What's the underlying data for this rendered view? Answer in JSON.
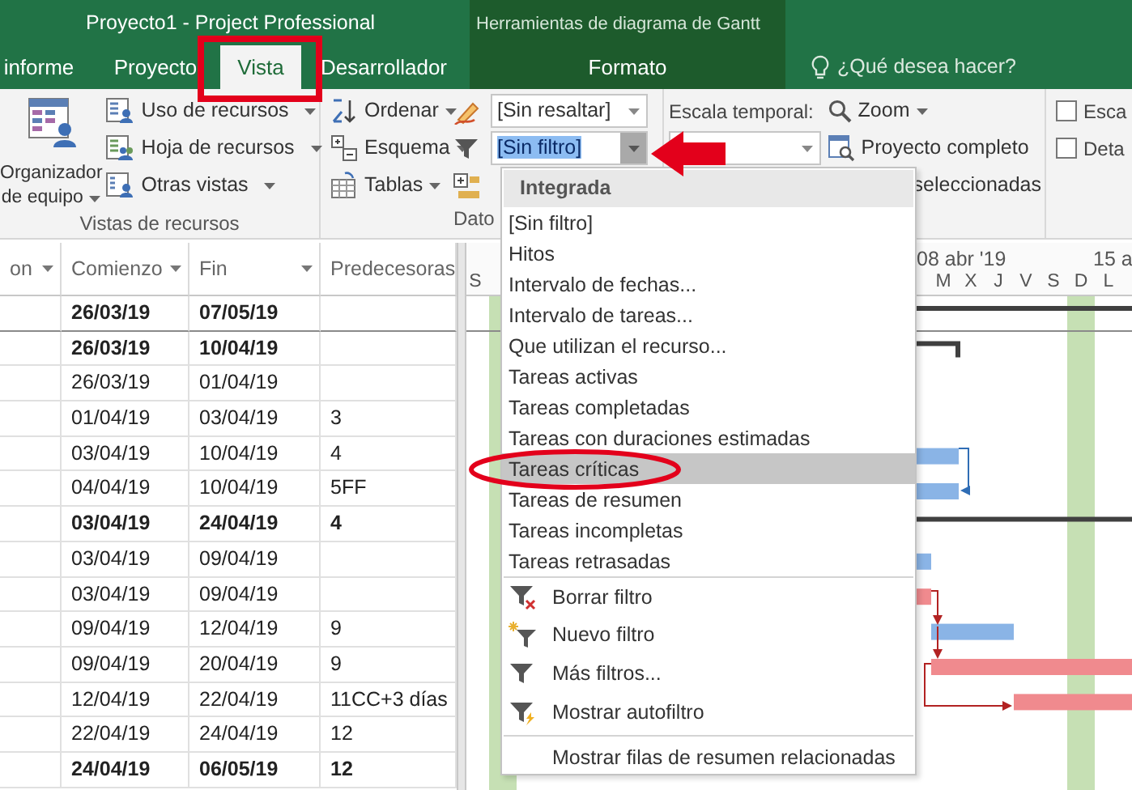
{
  "title_bar": {
    "title": "Proyecto1 - Project Professional",
    "contextual_title": "Herramientas de diagrama de Gantt",
    "contextual_tab": {
      "label": "Formato",
      "selected": false
    },
    "tell_me": "¿Qué desea hacer?"
  },
  "tabs": [
    {
      "label": "informe",
      "selected": false
    },
    {
      "label": "Proyecto",
      "selected": false
    },
    {
      "label": "Vista",
      "selected": true
    },
    {
      "label": "Desarrollador",
      "selected": false
    }
  ],
  "ribbon": {
    "resource_views": {
      "big_button_lines": [
        "Organizador",
        "de equipo"
      ],
      "buttons": [
        "Uso de recursos",
        "Hoja de recursos",
        "Otras vistas"
      ],
      "label": "Vistas de recursos"
    },
    "data": {
      "buttons": [
        "Ordenar",
        "Esquema",
        "Tablas"
      ],
      "highlight": "[Sin resaltar]",
      "filter": {
        "value": "[Sin filtro]",
        "open": true
      },
      "label": "Dato"
    },
    "zoom": {
      "timescale_label": "Escala temporal:",
      "zoom": "Zoom",
      "entire_project": "Proyecto completo",
      "selected_tasks": "seleccionadas"
    },
    "show": [
      {
        "label": "Esca",
        "checked": false
      },
      {
        "label": "Deta",
        "checked": false
      }
    ]
  },
  "table": {
    "columns": [
      "on",
      "Comienzo",
      "Fin",
      "Predecesoras"
    ],
    "rows": [
      {
        "start": "26/03/19",
        "finish": "07/05/19",
        "summary": true,
        "kind": "summary"
      },
      {
        "start": "26/03/19",
        "finish": "10/04/19",
        "summary": true,
        "kind": "summary"
      },
      {
        "start": "26/03/19",
        "finish": "01/04/19",
        "summary": false
      },
      {
        "start": "01/04/19",
        "finish": "03/04/19",
        "predecessors": "3",
        "summary": false
      },
      {
        "start": "03/04/19",
        "finish": "10/04/19",
        "predecessors": "4",
        "summary": false,
        "kind": "task"
      },
      {
        "start": "04/04/19",
        "finish": "10/04/19",
        "predecessors": "5FF",
        "summary": false,
        "kind": "task"
      },
      {
        "start": "03/04/19",
        "finish": "24/04/19",
        "predecessors": "4",
        "summary": true,
        "kind": "summary"
      },
      {
        "start": "03/04/19",
        "finish": "09/04/19",
        "summary": false,
        "kind": "task"
      },
      {
        "start": "03/04/19",
        "finish": "09/04/19",
        "summary": false,
        "kind": "critical"
      },
      {
        "start": "09/04/19",
        "finish": "12/04/19",
        "predecessors": "9",
        "summary": false,
        "kind": "task"
      },
      {
        "start": "09/04/19",
        "finish": "20/04/19",
        "predecessors": "9",
        "summary": false,
        "kind": "critical"
      },
      {
        "start": "12/04/19",
        "finish": "22/04/19",
        "predecessors": "11CC+3 días",
        "summary": false,
        "kind": "critical"
      },
      {
        "start": "22/04/19",
        "finish": "24/04/19",
        "predecessors": "12",
        "summary": false
      },
      {
        "start": "24/04/19",
        "finish": "06/05/19",
        "predecessors": "12",
        "summary": true
      }
    ]
  },
  "gantt": {
    "weeks": [
      "08 abr '19",
      "15 a"
    ],
    "days": [
      "S",
      "M",
      "X",
      "J",
      "V",
      "S",
      "D",
      "L"
    ]
  },
  "filter_menu": {
    "heading": "Integrada",
    "items": [
      {
        "label": "[Sin filtro]",
        "selected": false
      },
      {
        "label": "Hitos",
        "selected": false
      },
      {
        "label": "Intervalo de fechas...",
        "selected": false
      },
      {
        "label": "Intervalo de tareas...",
        "selected": false
      },
      {
        "label": "Que utilizan el recurso...",
        "selected": false
      },
      {
        "label": "Tareas activas",
        "selected": false
      },
      {
        "label": "Tareas completadas",
        "selected": false
      },
      {
        "label": "Tareas con duraciones estimadas",
        "selected": false
      },
      {
        "label": "Tareas críticas",
        "selected": true
      },
      {
        "label": "Tareas de resumen",
        "selected": false
      },
      {
        "label": "Tareas incompletas",
        "selected": false
      },
      {
        "label": "Tareas retrasadas",
        "selected": false
      }
    ],
    "commands": [
      {
        "label": "Borrar filtro",
        "kind": "clear"
      },
      {
        "label": "Nuevo filtro",
        "kind": "new"
      },
      {
        "label": "Más filtros...",
        "kind": "more"
      },
      {
        "label": "Mostrar autofiltro",
        "kind": "autofilter"
      }
    ],
    "footer": "Mostrar filas de resumen relacionadas"
  },
  "annotations": [
    {
      "kind": "box"
    },
    {
      "kind": "arrow"
    },
    {
      "kind": "ellipse"
    }
  ]
}
